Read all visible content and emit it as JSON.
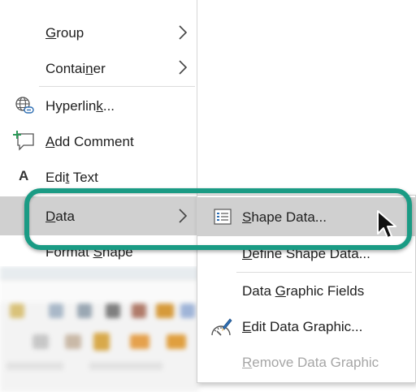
{
  "menu": {
    "items": [
      {
        "key": "group",
        "pre": "",
        "ul": "G",
        "post": "roup",
        "submenu": true
      },
      {
        "key": "container",
        "pre": "Contai",
        "ul": "n",
        "post": "er",
        "submenu": true
      },
      {
        "key": "hyperlink",
        "pre": "Hyperlin",
        "ul": "k",
        "post": "...",
        "icon": "globe-link-icon"
      },
      {
        "key": "add-comment",
        "pre": "",
        "ul": "A",
        "post": "dd Comment",
        "icon": "add-comment-icon"
      },
      {
        "key": "edit-text",
        "pre": "Edi",
        "ul": "t",
        "post": " Text",
        "icon": "text-a-icon",
        "icon_text": "A"
      },
      {
        "key": "data",
        "pre": "",
        "ul": "D",
        "post": "ata",
        "submenu": true,
        "highlighted": true
      },
      {
        "key": "format-shape",
        "pre": "Format ",
        "ul": "S",
        "post": "hape"
      }
    ]
  },
  "submenu": {
    "items": [
      {
        "key": "shape-data",
        "pre": "",
        "ul": "S",
        "post": "hape Data...",
        "icon": "shape-data-icon",
        "highlighted": true
      },
      {
        "key": "define-shape-data",
        "pre": "",
        "ul": "D",
        "post": "efine Shape Data..."
      },
      {
        "key": "data-graphic-fields",
        "pre": "Data ",
        "ul": "G",
        "post": "raphic Fields"
      },
      {
        "key": "edit-data-graphic",
        "pre": "",
        "ul": "E",
        "post": "dit Data Graphic...",
        "icon": "edit-data-graphic-icon"
      },
      {
        "key": "remove-data-graphic",
        "pre": "",
        "ul": "R",
        "post": "emove Data Graphic",
        "disabled": true
      }
    ]
  },
  "colors": {
    "highlight_outline": "#1a9b84",
    "selected_row": "#d0d0d0",
    "menu_bg": "#ffffff",
    "disabled_text": "#a6a6a6"
  }
}
